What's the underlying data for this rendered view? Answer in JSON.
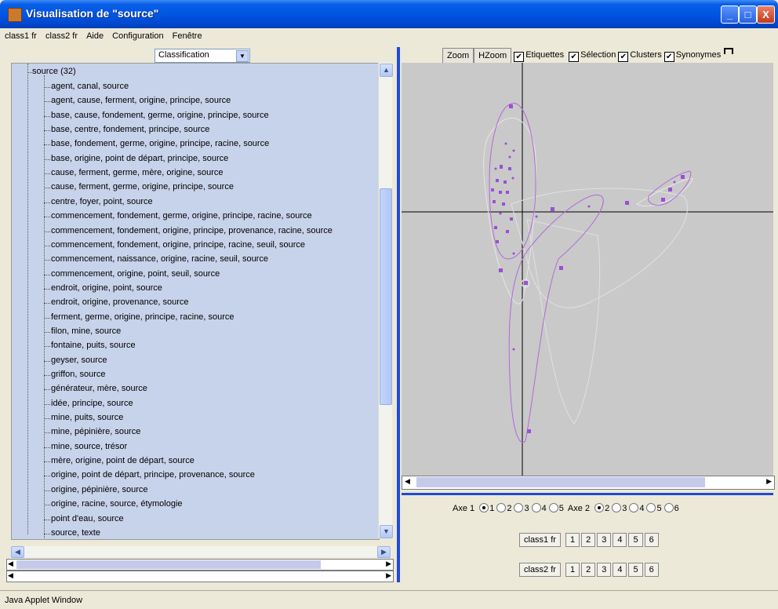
{
  "window": {
    "title": "Visualisation de \"source\"",
    "min": "_",
    "max": "□",
    "close": "X"
  },
  "menu": [
    "class1 fr",
    "class2 fr",
    "Aide",
    "Configuration",
    "Fenêtre"
  ],
  "combo": {
    "value": "Classification"
  },
  "tree": {
    "root": "source (32)",
    "items": [
      "agent, canal, source",
      "agent, cause, ferment, origine, principe, source",
      "base, cause, fondement, germe, origine, principe, source",
      "base, centre, fondement, principe, source",
      "base, fondement, germe, origine, principe, racine, source",
      "base, origine, point de départ, principe, source",
      "cause, ferment, germe, mère, origine, source",
      "cause, ferment, germe, origine, principe, source",
      "centre, foyer, point, source",
      "commencement, fondement, germe, origine, principe, racine, source",
      "commencement, fondement, origine, principe, provenance, racine, source",
      "commencement, fondement, origine, principe, racine, seuil, source",
      "commencement, naissance, origine, racine, seuil, source",
      "commencement, origine, point, seuil, source",
      "endroit, origine, point, source",
      "endroit, origine, provenance, source",
      "ferment, germe, origine, principe, racine, source",
      "filon, mine, source",
      "fontaine, puits, source",
      "geyser, source",
      "griffon, source",
      "générateur, mère, source",
      "idée, principe, source",
      "mine, puits, source",
      "mine, pépinière, source",
      "mine, source, trésor",
      "mère, origine, point de départ, source",
      "origine, point de départ, principe, provenance, source",
      "origine, pépinière, source",
      "origine, racine, source, étymologie",
      "point d'eau, source",
      "source, texte"
    ]
  },
  "toolbar": {
    "zoom": "Zoom",
    "hzoom": "HZoom",
    "checks": [
      {
        "label": "Etiquettes",
        "checked": true
      },
      {
        "label": "Sélection",
        "checked": true
      },
      {
        "label": "Clusters",
        "checked": true
      },
      {
        "label": "Synonymes",
        "checked": true
      }
    ]
  },
  "axes": {
    "axe1_label": "Axe 1",
    "axe1_options": [
      "1",
      "2",
      "3",
      "4",
      "5"
    ],
    "axe1_selected": "1",
    "axe2_label": "Axe 2",
    "axe2_options": [
      "2",
      "3",
      "4",
      "5",
      "6"
    ],
    "axe2_selected": "2"
  },
  "class1": {
    "label": "class1 fr",
    "buttons": [
      "1",
      "2",
      "3",
      "4",
      "5",
      "6"
    ]
  },
  "class2": {
    "label": "class2 fr",
    "buttons": [
      "1",
      "2",
      "3",
      "4",
      "5",
      "6"
    ]
  },
  "status": "Java Applet Window",
  "colors": {
    "cluster": "#b06ad8",
    "point": "#9a4fd6",
    "axis": "#000000",
    "panel_bg": "#c7d3ea",
    "plot_bg": "#c9c9c9"
  }
}
